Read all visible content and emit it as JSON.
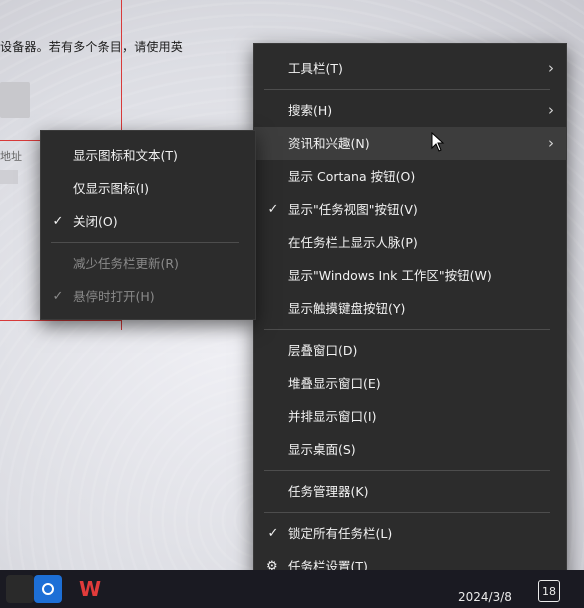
{
  "background": {
    "text_line": "设备器。若有多个条目，请使用英",
    "text_line_2": "地址"
  },
  "main_menu": {
    "items": [
      {
        "label": "工具栏(T)",
        "checked": false,
        "has_submenu": true
      },
      {
        "label": "搜索(H)",
        "checked": false,
        "has_submenu": true
      },
      {
        "label": "资讯和兴趣(N)",
        "checked": false,
        "has_submenu": true,
        "highlighted": true
      },
      {
        "label": "显示 Cortana 按钮(O)",
        "checked": false
      },
      {
        "label": "显示\"任务视图\"按钮(V)",
        "checked": true
      },
      {
        "label": "在任务栏上显示人脉(P)",
        "checked": false
      },
      {
        "label": "显示\"Windows Ink 工作区\"按钮(W)",
        "checked": false
      },
      {
        "label": "显示触摸键盘按钮(Y)",
        "checked": false
      },
      {
        "label": "层叠窗口(D)",
        "checked": false
      },
      {
        "label": "堆叠显示窗口(E)",
        "checked": false
      },
      {
        "label": "并排显示窗口(I)",
        "checked": false
      },
      {
        "label": "显示桌面(S)",
        "checked": false
      },
      {
        "label": "任务管理器(K)",
        "checked": false
      },
      {
        "label": "锁定所有任务栏(L)",
        "checked": true
      },
      {
        "label": "任务栏设置(T)",
        "checked": false,
        "icon": "gear-icon"
      }
    ],
    "check_glyph": "✓",
    "arrow_glyph": "›",
    "gear_glyph": "⚙"
  },
  "sub_menu": {
    "items": [
      {
        "label": "显示图标和文本(T)",
        "checked": false,
        "disabled": false
      },
      {
        "label": "仅显示图标(I)",
        "checked": false,
        "disabled": false
      },
      {
        "label": "关闭(O)",
        "checked": true,
        "disabled": false
      },
      {
        "label": "减少任务栏更新(R)",
        "checked": false,
        "disabled": true
      },
      {
        "label": "悬停时打开(H)",
        "checked": true,
        "disabled": true
      }
    ]
  },
  "taskbar": {
    "date": "2024/3/8",
    "badge": "18"
  },
  "colors": {
    "menu_bg": "#2c2c2c",
    "menu_text": "#f2f2f2",
    "disabled_text": "#8a8a8a",
    "highlight_bg": "#3d3d3d",
    "taskbar_bg": "#1a1a22"
  }
}
